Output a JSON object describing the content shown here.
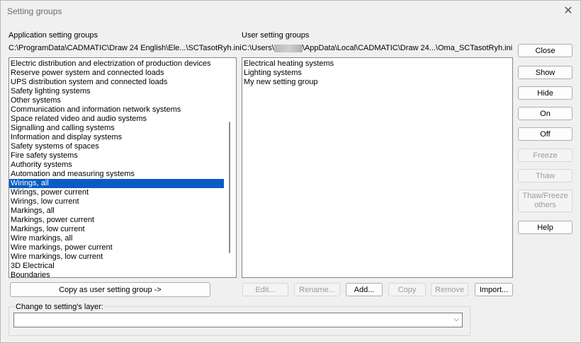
{
  "window": {
    "title": "Setting groups",
    "close_glyph": "✕"
  },
  "app_groups": {
    "label": "Application setting groups",
    "path": "C:\\ProgramData\\CADMATIC\\Draw 24 English\\Ele...\\SCTasotRyh.ini",
    "items": [
      "Electric distribution and electrization of production devices",
      "Reserve power system and connected loads",
      "UPS distribution system and connected loads",
      "Safety lighting systems",
      "Other systems",
      "Communication and information network systems",
      "Space related video and audio systems",
      "Signalling and calling systems",
      "Information and display systems",
      "Safety systems of spaces",
      "Fire safety systems",
      "Authority systems",
      "Automation and measuring systems",
      "Wirings, all",
      "Wirings, power current",
      "Wirings, low current",
      "Markings, all",
      "Markings, power current",
      "Markings, low current",
      "Wire markings, all",
      "Wire markings, power current",
      "Wire markings, low current",
      "3D Electrical",
      "Boundaries"
    ],
    "selected": "Wirings, all",
    "copy_button": "Copy as user setting group ->"
  },
  "user_groups": {
    "label": "User setting groups",
    "path_prefix": "C:\\Users\\",
    "path_suffix": "\\AppData\\Local\\CADMATIC\\Draw 24...\\Oma_SCTasotRyh.ini",
    "items": [
      "Electrical heating systems",
      "Lighting systems",
      "My new setting group"
    ],
    "buttons": {
      "edit": "Edit...",
      "rename": "Rename...",
      "add": "Add...",
      "copy": "Copy",
      "remove": "Remove",
      "import": "Import..."
    }
  },
  "side_buttons": {
    "close": "Close",
    "show": "Show",
    "hide": "Hide",
    "on": "On",
    "off": "Off",
    "freeze": "Freeze",
    "thaw": "Thaw",
    "thaw_freeze_1": "Thaw/Freeze",
    "thaw_freeze_2": "others",
    "help": "Help"
  },
  "layer": {
    "label": "Change to setting's layer:",
    "value": "",
    "chevron": "⌵"
  }
}
